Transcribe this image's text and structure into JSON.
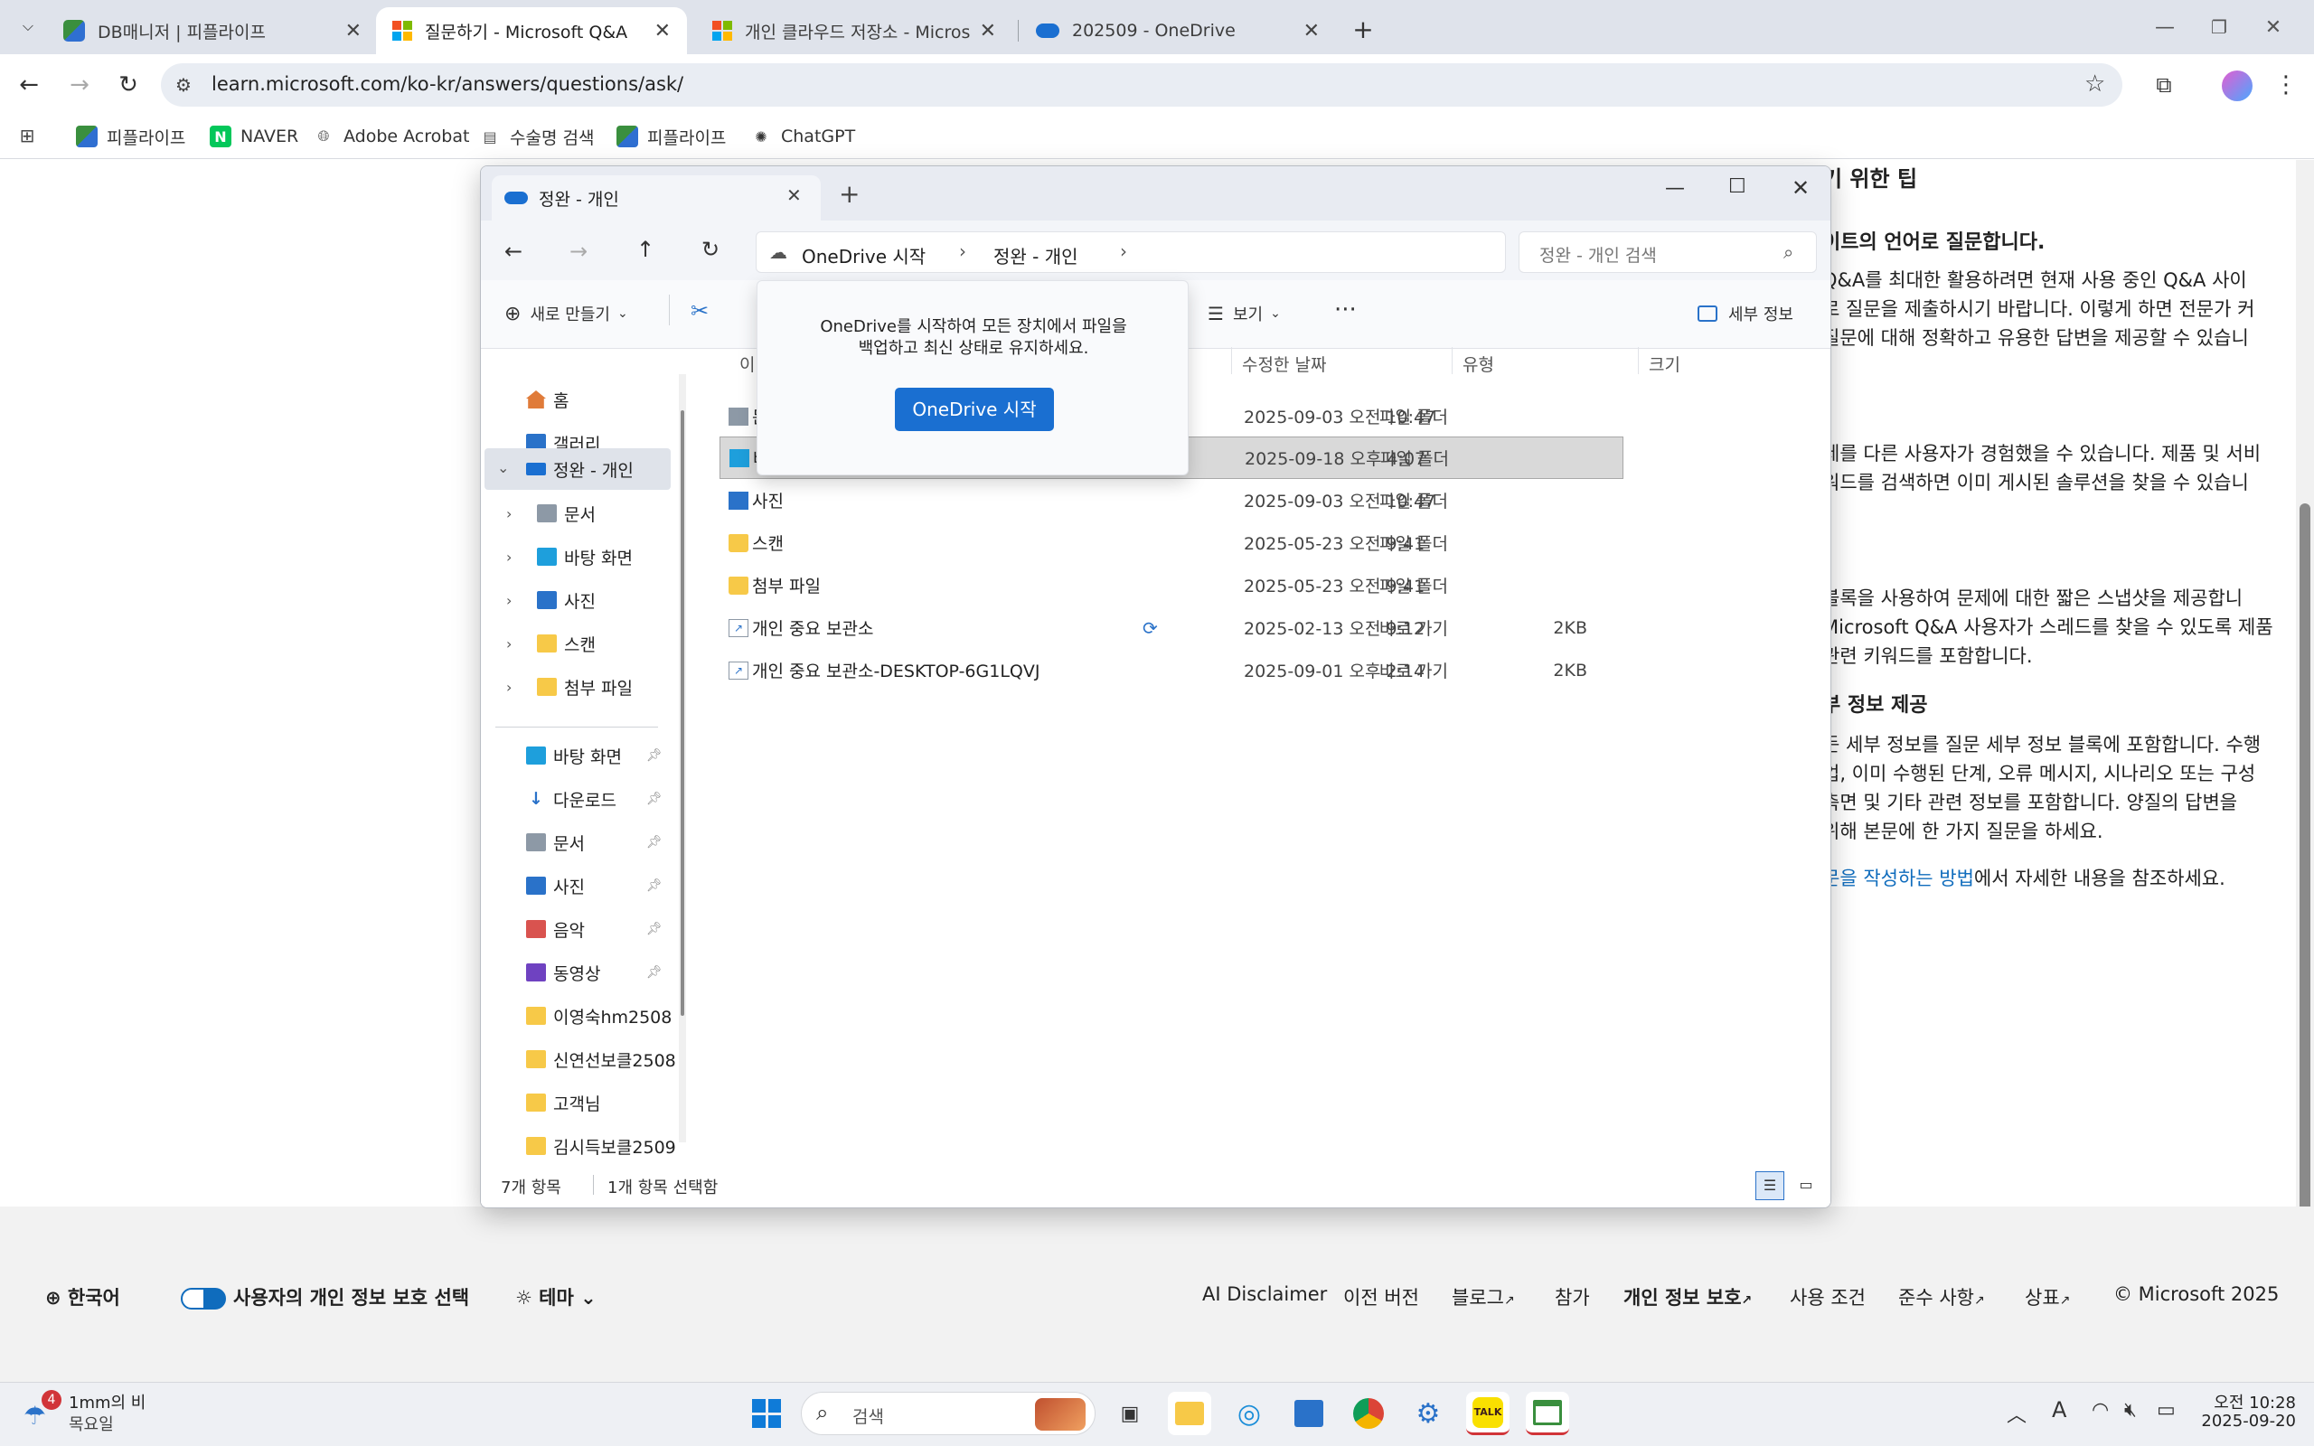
{
  "browser": {
    "tabs": [
      {
        "label": "DB매니저 | 피플라이프",
        "icon": "puzzle-icon"
      },
      {
        "label": "질문하기 - Microsoft Q&A",
        "icon": "microsoft-icon"
      },
      {
        "label": "개인 클라우드 저장소 - Micros",
        "icon": "microsoft-icon"
      },
      {
        "label": "202509 - OneDrive",
        "icon": "onedrive-icon"
      }
    ],
    "url": "learn.microsoft.com/ko-kr/answers/questions/ask/",
    "bookmarks": [
      "피플라이프",
      "NAVER",
      "Adobe Acrobat",
      "수술명 검색",
      "피플라이프",
      "ChatGPT"
    ]
  },
  "page": {
    "heading_tips": "기 위한 팁",
    "h_language": "이트의 언어로 질문합니다.",
    "p1": [
      " Q&A를 최대한 활용하려면 현재 사용 중인 Q&A 사이",
      "로 질문을 제출하시기 바랍니다. 이렇게 하면 전문가 커",
      "질문에 대해 정확하고 유용한 답변을 제공할 수 있습니"
    ],
    "p2": [
      "제를 다른 사용자가 경험했을 수 있습니다. 제품 및 서비",
      "워드를 검색하면 이미 게시된 솔루션을 찾을 수 있습니"
    ],
    "p3": [
      " 블록을 사용하여 문제에 대한 짧은 스냅샷을 제공합니",
      "Microsoft Q&A 사용자가 스레드를 찾을 수 있도록 제품",
      "관련 키워드를 포함합니다."
    ],
    "h_detail": "부 정보 제공",
    "p4": [
      "든 세부 정보를 질문 세부 정보 블록에 포함합니다. 수행",
      "업, 이미 수행된 단계, 오류 메시지, 시나리오 또는 구성",
      "측면 및 기타 관련 정보를 포함합니다. 양질의 답변을",
      "위해 본문에 한 가지 질문을 하세요."
    ],
    "link_text": "문을 작성하는 방법",
    "link_after": "에서 자세한 내용을 참조하세요."
  },
  "footer": {
    "language": "한국어",
    "privacy_choice": "사용자의 개인 정보 보호 선택",
    "theme": "테마",
    "links": [
      "AI Disclaimer",
      "이전 버전",
      "블로그",
      "참가",
      "개인 정보 보호",
      "사용 조건",
      "준수 사항",
      "상표",
      "© Microsoft 2025"
    ]
  },
  "explorer": {
    "tab_title": "정완 - 개인",
    "breadcrumb": [
      "OneDrive 시작",
      "정완 - 개인"
    ],
    "search_placeholder": "정완 - 개인 검색",
    "cmd": {
      "new": "새로 만들기",
      "view": "보기",
      "details": "세부 정보"
    },
    "popup": {
      "message_l1": "OneDrive를 시작하여 모든 장치에서 파일을",
      "message_l2": "백업하고 최신 상태로 유지하세요.",
      "button": "OneDrive 시작"
    },
    "columns": {
      "name": "이",
      "modified": "수정한 날짜",
      "type": "유형",
      "size": "크기"
    },
    "nav": {
      "home": "홈",
      "gallery": "갤러리",
      "onedrive": "정완 - 개인",
      "children": [
        "문서",
        "바탕 화면",
        "사진",
        "스캔",
        "첨부 파일"
      ],
      "quick": [
        "바탕 화면",
        "다운로드",
        "문서",
        "사진",
        "음악",
        "동영상",
        "이영숙hm2508",
        "신연선보클2508",
        "고객님",
        "김시득보클2509"
      ]
    },
    "files": [
      {
        "name": "문",
        "modified": "2025-09-03 오전 10:47",
        "type": "파일 폴더",
        "size": "",
        "icon": "document-folder-icon"
      },
      {
        "name": "바",
        "modified": "2025-09-18 오후 4:07",
        "type": "파일 폴더",
        "size": "",
        "icon": "desktop-folder-icon"
      },
      {
        "name": "사진",
        "modified": "2025-09-03 오전 10:47",
        "type": "파일 폴더",
        "size": "",
        "icon": "pictures-folder-icon"
      },
      {
        "name": "스캔",
        "modified": "2025-05-23 오전 9:41",
        "type": "파일 폴더",
        "size": "",
        "icon": "folder-icon"
      },
      {
        "name": "첨부 파일",
        "modified": "2025-05-23 오전 9:41",
        "type": "파일 폴더",
        "size": "",
        "icon": "folder-icon"
      },
      {
        "name": "개인 중요 보관소",
        "modified": "2025-02-13 오전 9:12",
        "type": "바로 가기",
        "size": "2KB",
        "icon": "shortcut-icon"
      },
      {
        "name": "개인 중요 보관소-DESKTOP-6G1LQVJ",
        "modified": "2025-09-01 오후 2:14",
        "type": "바로 가기",
        "size": "2KB",
        "icon": "shortcut-icon"
      }
    ],
    "status": {
      "count": "7개 항목",
      "selected": "1개 항목 선택함"
    }
  },
  "taskbar": {
    "weather": {
      "badge": "4",
      "line1": "1mm의 비",
      "line2": "목요일"
    },
    "search": "검색",
    "clock": {
      "time": "오전 10:28",
      "date": "2025-09-20"
    },
    "ime": "A"
  }
}
